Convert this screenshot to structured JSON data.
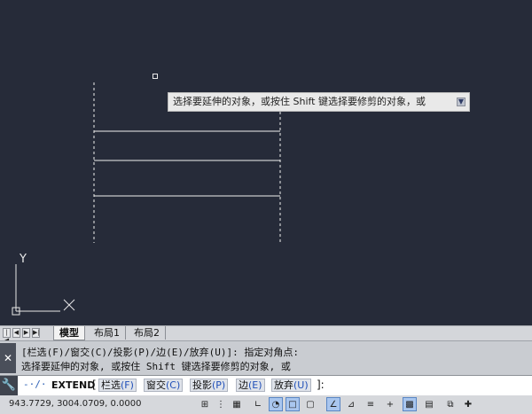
{
  "canvas": {
    "tooltip": "选择要延伸的对象，或按住 Shift 键选择要修剪的对象，或",
    "tooltip_arrow_icon": "dropdown-arrow-icon",
    "ucs_y_label": "Y",
    "ucs_x_icon": "ucs-x-axis-icon",
    "colors": {
      "background": "#262b39",
      "linework": "#f0f0f0"
    }
  },
  "tabs": {
    "nav_icons": [
      "first-tab-icon",
      "prev-tab-icon",
      "next-tab-icon",
      "last-tab-icon"
    ],
    "items": [
      {
        "label": "模型",
        "active": true
      },
      {
        "label": "布局1",
        "active": false
      },
      {
        "label": "布局2",
        "active": false
      }
    ]
  },
  "command_history": {
    "line1": "[栏选(F)/窗交(C)/投影(P)/边(E)/放弃(U)]: 指定对角点:",
    "line2": "选择要延伸的对象, 或按住 Shift 键选择要修剪的对象, 或"
  },
  "command_line": {
    "icon_glyph": "-·/·",
    "command": "EXTEND",
    "open_bracket": "[",
    "options": [
      {
        "name": "栏选",
        "key": "(F)"
      },
      {
        "name": "窗交",
        "key": "(C)"
      },
      {
        "name": "投影",
        "key": "(P)"
      },
      {
        "name": "边",
        "key": "(E)"
      },
      {
        "name": "放弃",
        "key": "(U)"
      }
    ],
    "tail": "]:"
  },
  "status_bar": {
    "coordinates": "943.7729,   3004.0709,  0.0000"
  }
}
